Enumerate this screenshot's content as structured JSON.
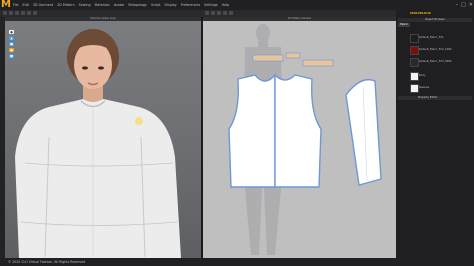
{
  "app": {
    "logo": "M",
    "menus": [
      "File",
      "Edit",
      "3D Garment",
      "2D Pattern",
      "Sewing",
      "Materials",
      "Avatar",
      "Retopology",
      "Script",
      "Display",
      "Preferences",
      "Settings",
      "Help"
    ],
    "window_controls": [
      "–",
      "□",
      "✕"
    ]
  },
  "views": {
    "view3d_title": "Hide the avatar body",
    "view2d_title": "2D Pattern Window"
  },
  "right_panel": {
    "brand": "MARVELOUS",
    "section_title": "Object Browser",
    "tab": "Fabric",
    "fabrics": [
      {
        "name": "Default_Fabric_FV1",
        "swatch": "#1d1d1d"
      },
      {
        "name": "Default_Fabric_FV2_1084",
        "swatch": "#7a0f0f"
      },
      {
        "name": "Default_Fabric_FV3_5084",
        "swatch": "#2a2a2a"
      },
      {
        "name": "Body",
        "swatch": "#f2f2f2"
      },
      {
        "name": "Sleeves",
        "swatch": "#f2f2f2"
      }
    ],
    "property_header": "Property Editor"
  },
  "status": {
    "copyright": "© 2020 CLO Virtual Fashion. All Rights Reserved"
  },
  "colors": {
    "accent": "#f5a623",
    "pattern_outline": "#6f97d6",
    "pattern_fill": "#ffffff",
    "binding": "#e8c49a"
  }
}
